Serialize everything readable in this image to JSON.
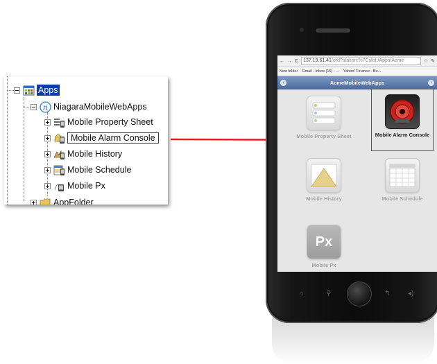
{
  "tree": {
    "items": [
      {
        "label": "Apps",
        "icon": "apps-folder-icon"
      },
      {
        "label": "NiagaraMobileWebApps",
        "icon": "niagara-n-icon"
      },
      {
        "label": "Mobile Property Sheet",
        "icon": "property-sheet-icon"
      },
      {
        "label": "Mobile Alarm Console",
        "icon": "alarm-console-icon"
      },
      {
        "label": "Mobile History",
        "icon": "history-icon"
      },
      {
        "label": "Mobile Schedule",
        "icon": "schedule-icon"
      },
      {
        "label": "Mobile Px",
        "icon": "px-icon"
      },
      {
        "label": "AppFolder",
        "icon": "folder-icon"
      }
    ],
    "selected": "Apps",
    "highlighted": "Mobile Alarm Console"
  },
  "arrow": {
    "color": "#e02020",
    "icon": "red-arrow-icon"
  },
  "phone": {
    "browser": {
      "url_host": "137.19.61.41",
      "url_path": "/ord?station:%7Cslot:/Apps/Acme",
      "bookmarks": [
        "New folder",
        "Gmail - Inbox (16) - ...",
        "Yahoo! Finance - Bu..."
      ]
    },
    "app_title": "AcmeMobileWebApps",
    "tiles": [
      {
        "label": "Mobile Property Sheet",
        "active": false,
        "icon": "property-sheet-icon"
      },
      {
        "label": "Mobile Alarm Console",
        "active": true,
        "icon": "alarm-icon"
      },
      {
        "label": "Mobile History",
        "active": false,
        "icon": "history-chart-icon"
      },
      {
        "label": "Mobile Schedule",
        "active": false,
        "icon": "schedule-grid-icon"
      },
      {
        "label": "Mobile Px",
        "active": false,
        "icon": "px-icon"
      }
    ],
    "px_text": "Px"
  },
  "colors": {
    "selection": "#0a3dab",
    "app_bar": "#5a78a8",
    "arrow": "#e02020"
  }
}
